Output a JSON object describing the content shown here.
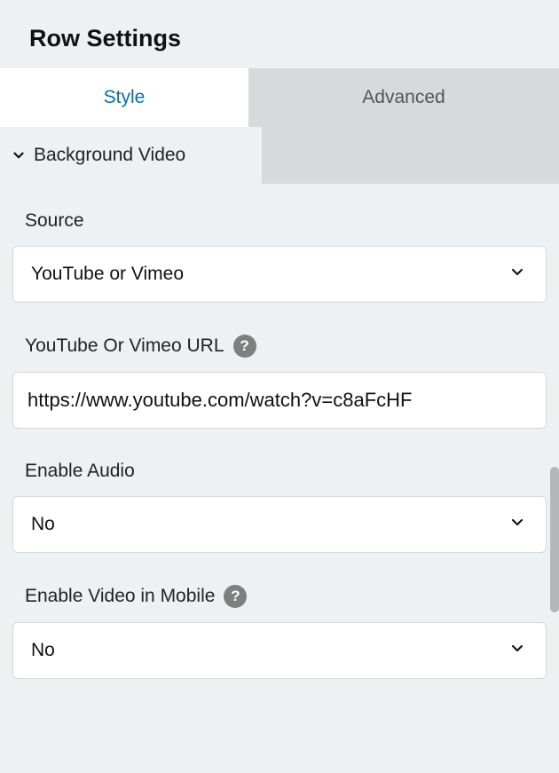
{
  "panel": {
    "title": "Row Settings"
  },
  "tabs": {
    "style": "Style",
    "advanced": "Advanced",
    "active": "style"
  },
  "section": {
    "background_video": {
      "label": "Background Video",
      "expanded": true
    }
  },
  "fields": {
    "source": {
      "label": "Source",
      "value": "YouTube or Vimeo"
    },
    "url": {
      "label": "YouTube Or Vimeo URL",
      "value": "https://www.youtube.com/watch?v=c8aFcHF",
      "help": true
    },
    "enable_audio": {
      "label": "Enable Audio",
      "value": "No"
    },
    "enable_video_mobile": {
      "label": "Enable Video in Mobile",
      "value": "No",
      "help": true
    }
  }
}
